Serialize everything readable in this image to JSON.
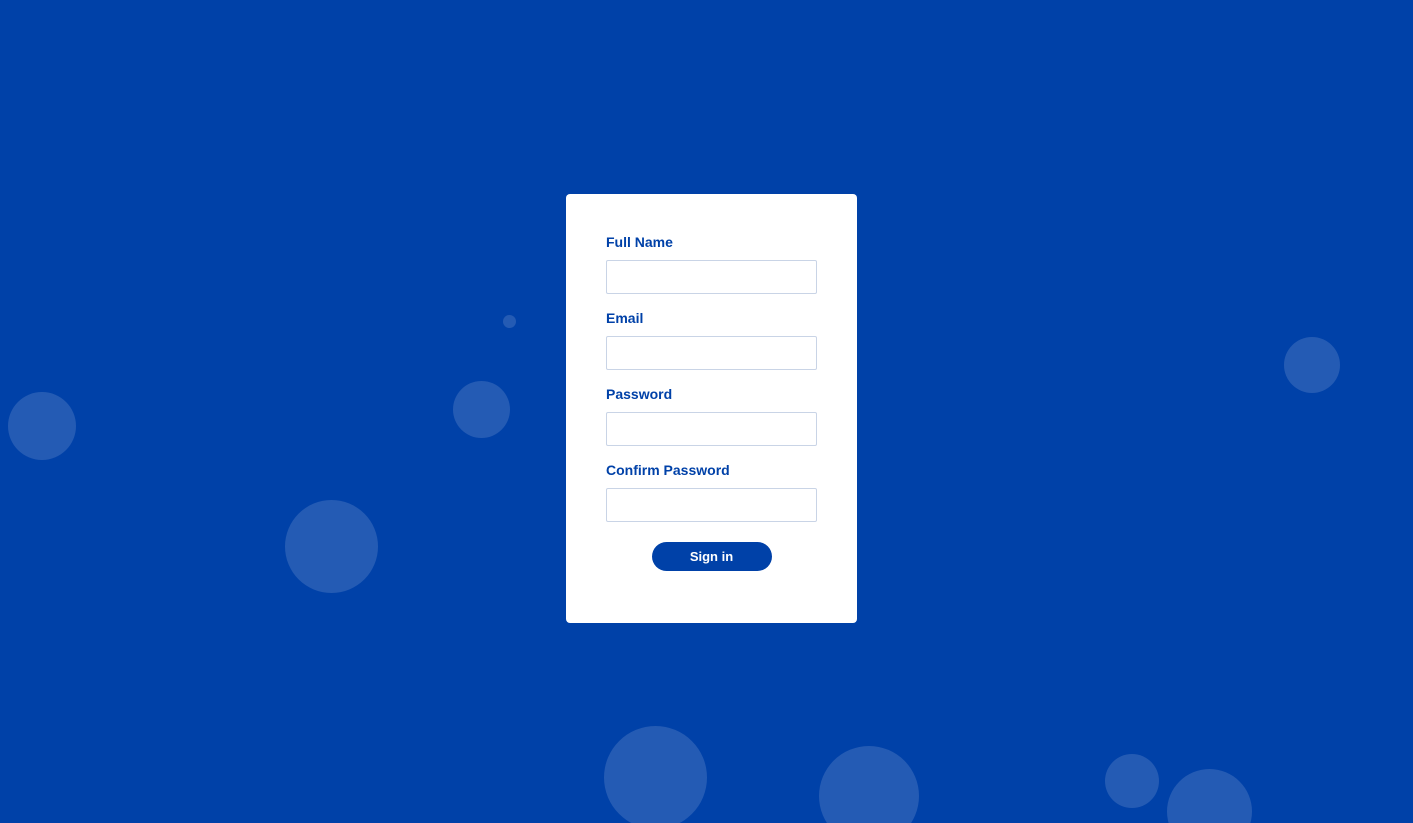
{
  "theme": {
    "background_color": "#0041a8",
    "accent_color": "#0041a8",
    "card_color": "#ffffff"
  },
  "form": {
    "fields": [
      {
        "label": "Full Name",
        "value": "",
        "placeholder": ""
      },
      {
        "label": "Email",
        "value": "",
        "placeholder": ""
      },
      {
        "label": "Password",
        "value": "",
        "placeholder": ""
      },
      {
        "label": "Confirm Password",
        "value": "",
        "placeholder": ""
      }
    ],
    "submit_label": "Sign in"
  }
}
